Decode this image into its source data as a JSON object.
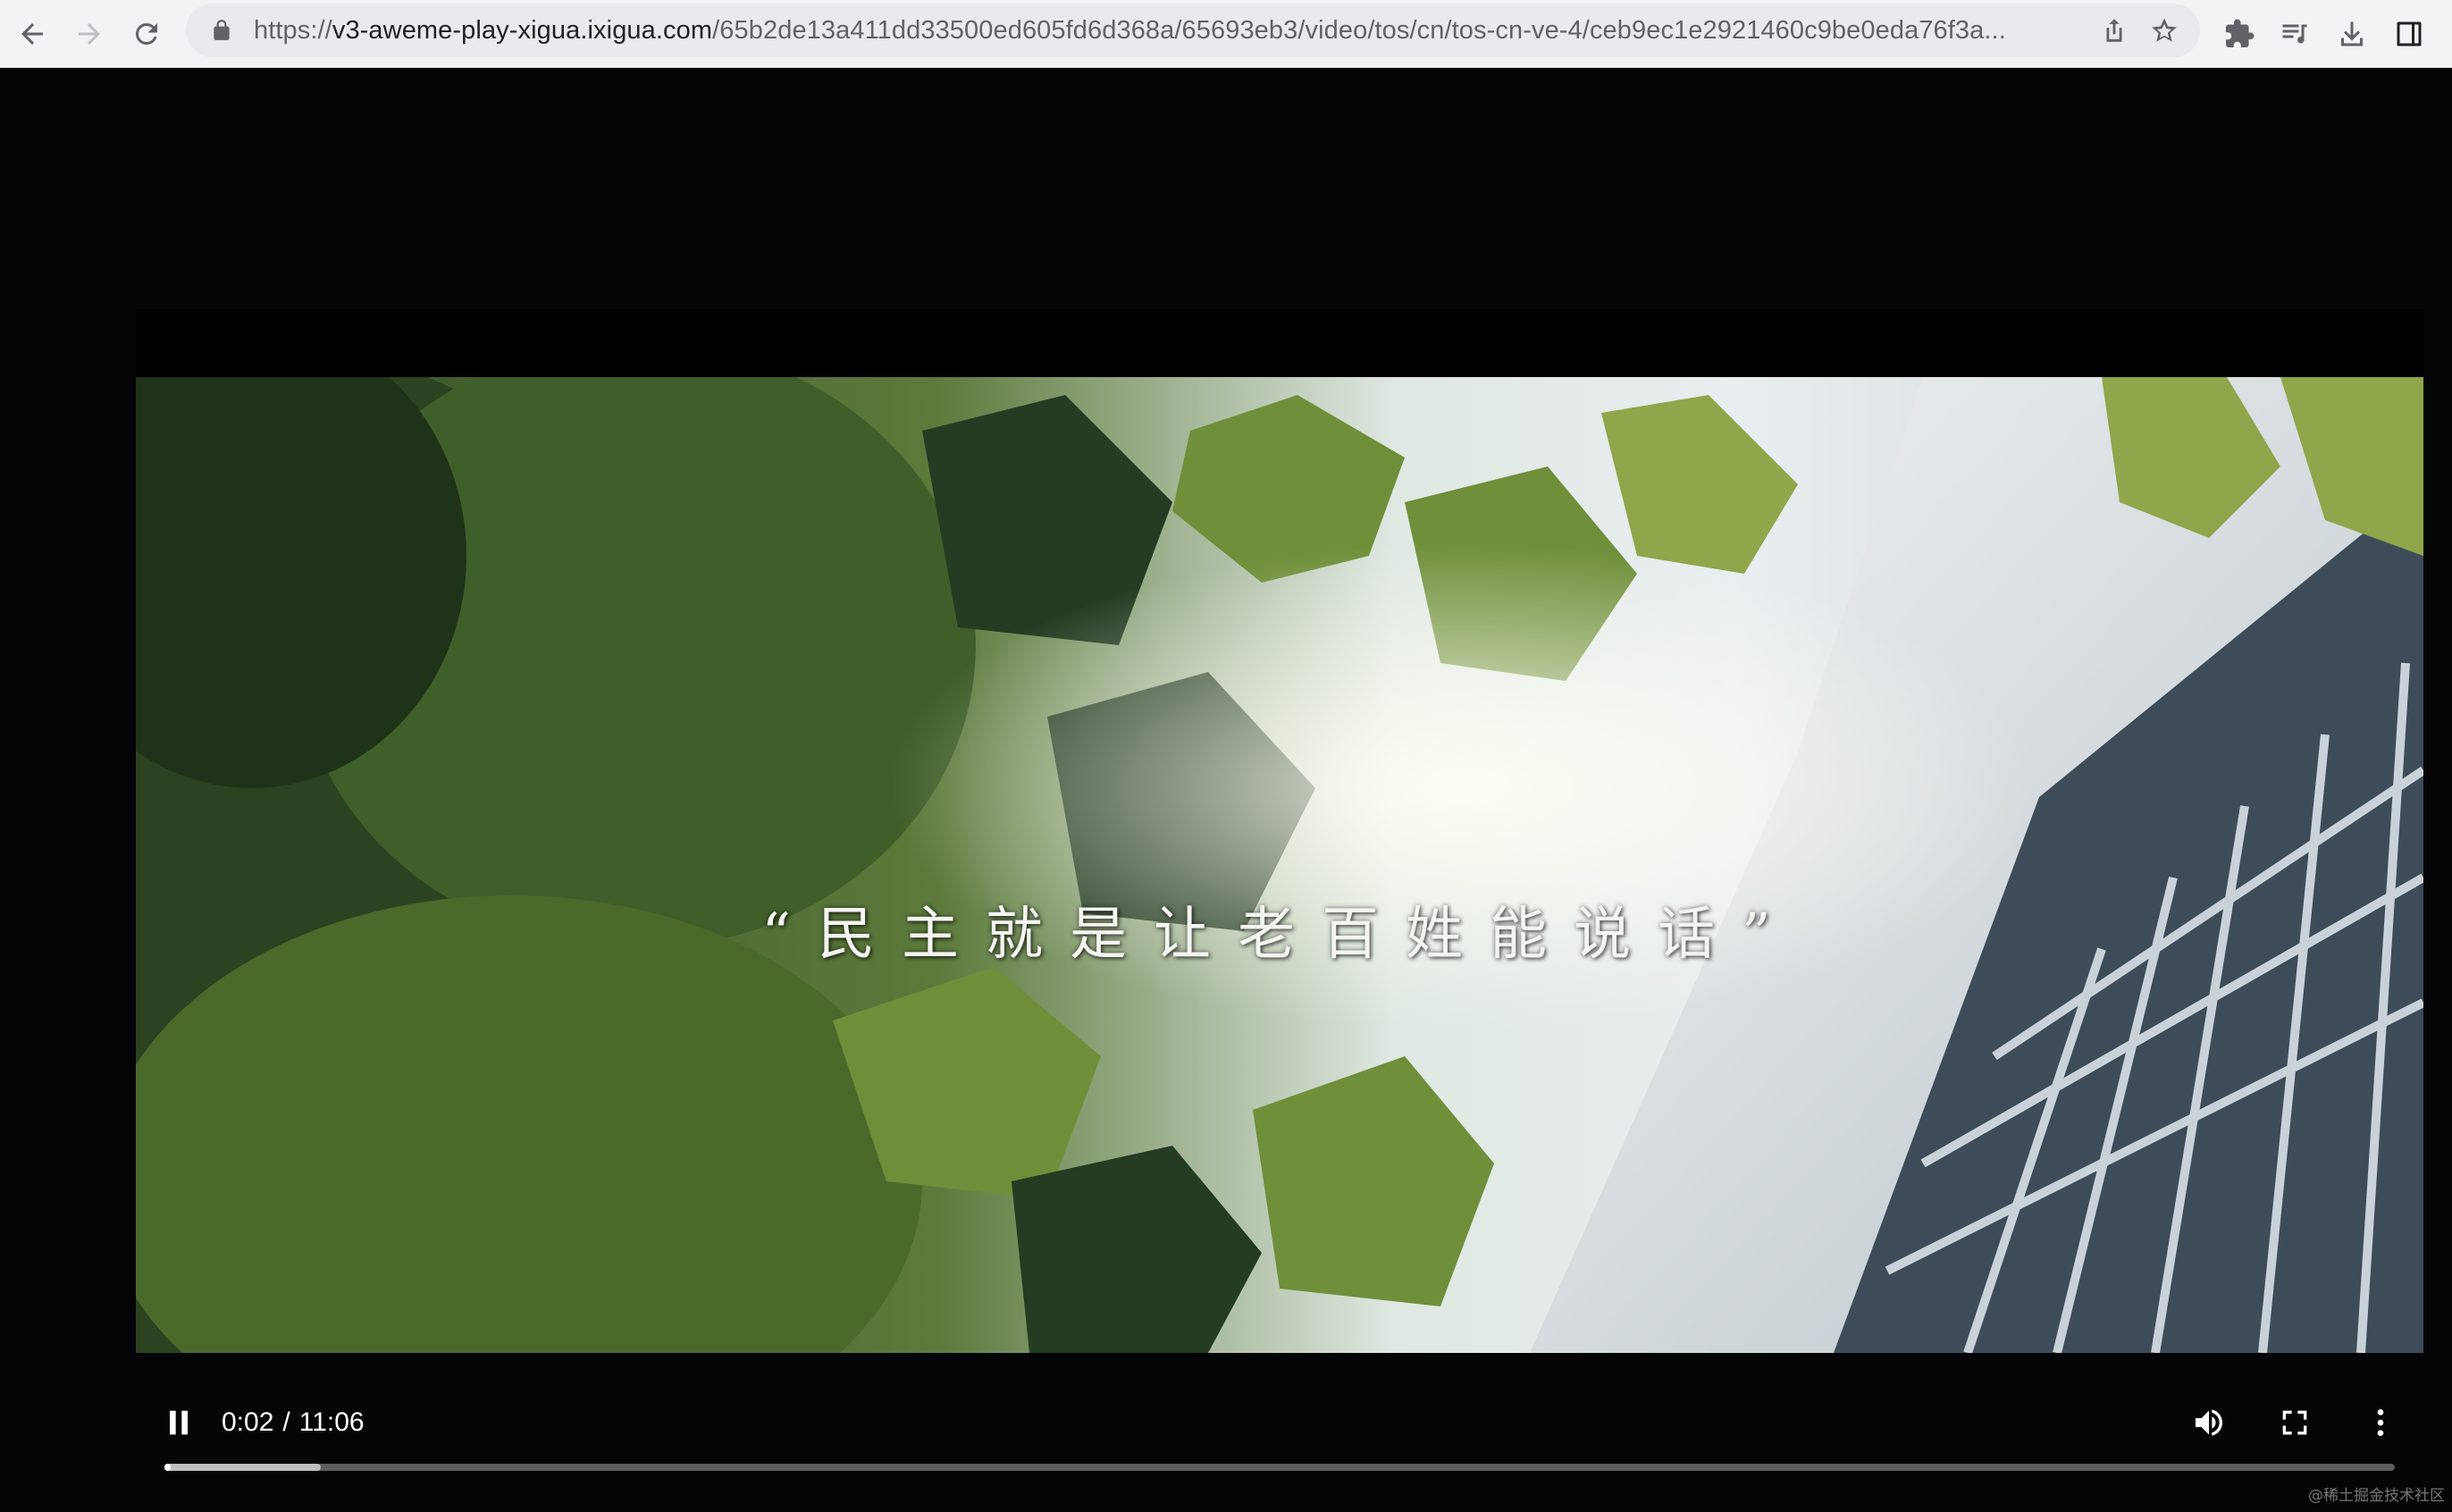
{
  "browser": {
    "back_button": "back",
    "forward_button": "forward",
    "reload_button": "reload",
    "url_scheme": "https://",
    "url_host": "v3-aweme-play-xigua.ixigua.com",
    "url_path": "/65b2de13a411dd33500ed605fd6d368a/65693eb3/video/tos/cn/tos-cn-ve-4/ceb9ec1e2921460c9be0eda76f3a...",
    "icons": [
      "back-icon",
      "forward-icon",
      "reload-icon",
      "lock-icon",
      "share-icon",
      "star-icon",
      "extensions-icon",
      "media-control-icon",
      "download-icon",
      "side-panel-icon"
    ]
  },
  "video": {
    "subtitle": "“民主就是让老百姓能说话”"
  },
  "player": {
    "state": "playing",
    "current_time": "0:02",
    "separator": "/",
    "duration": "11:06",
    "progress_played_fraction": 0.003,
    "progress_buffered_fraction": 0.07,
    "icons": [
      "pause-icon",
      "volume-icon",
      "fullscreen-icon",
      "more-options-icon"
    ]
  },
  "watermark": "@稀土掘金技术社区",
  "colors": {
    "toolbar_bg": "#f1f3f4",
    "omnibox_bg": "#e8eaed",
    "player_bg": "#000000",
    "control_fg": "#ffffff"
  }
}
